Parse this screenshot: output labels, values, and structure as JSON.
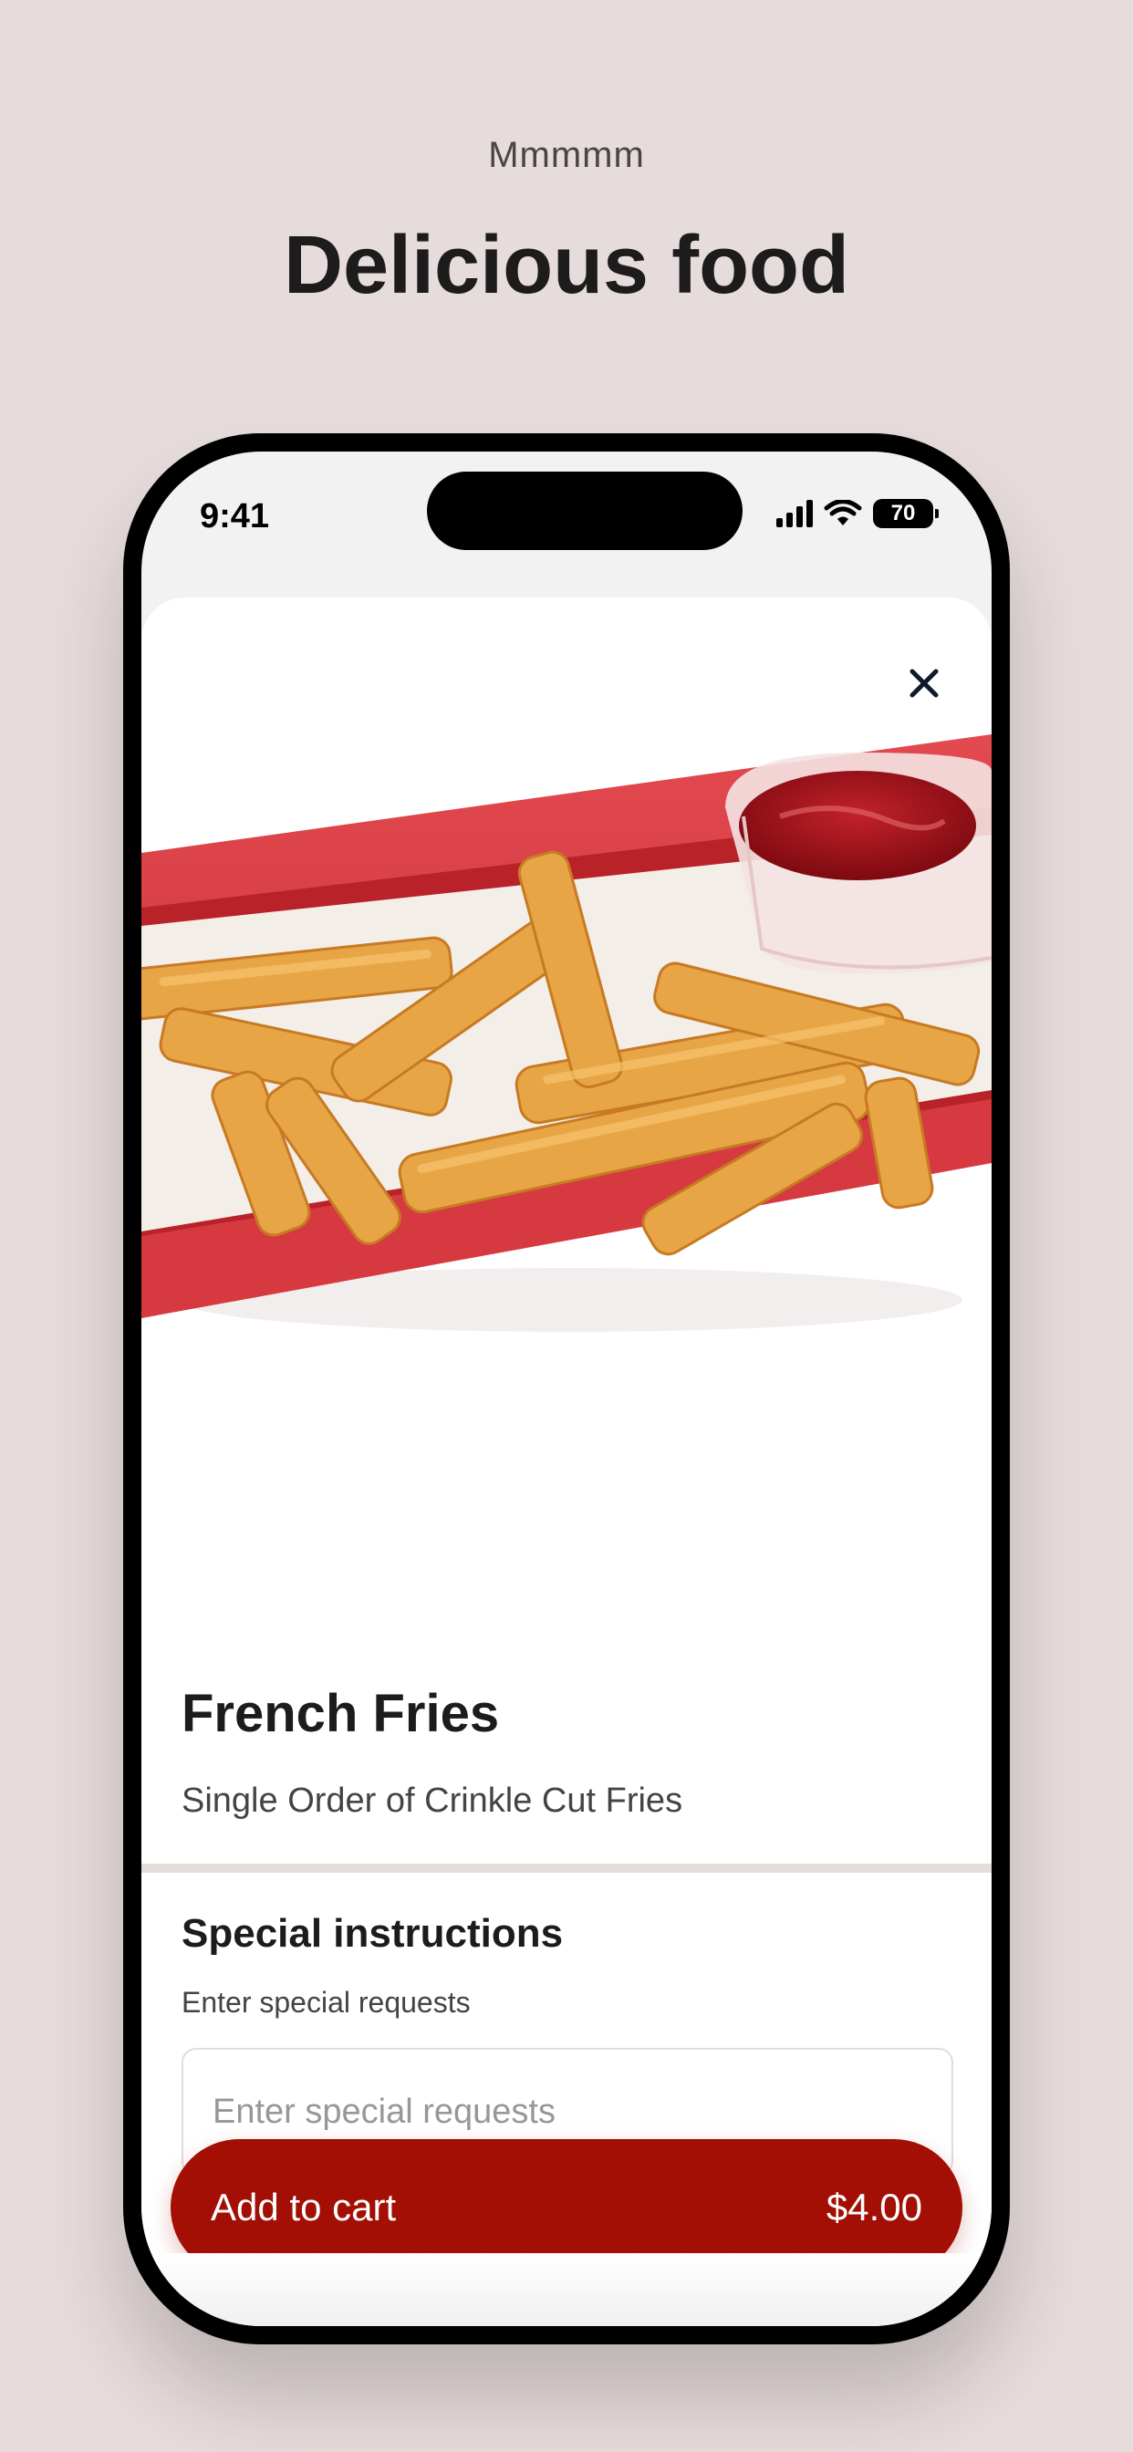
{
  "page": {
    "kicker": "Mmmmm",
    "headline": "Delicious food"
  },
  "status_bar": {
    "time": "9:41",
    "battery": "70",
    "icons": [
      "signal-icon",
      "wifi-icon",
      "battery-icon"
    ]
  },
  "sheet": {
    "close_icon": "close-icon"
  },
  "product": {
    "name": "French Fries",
    "description": "Single Order of Crinkle Cut Fries",
    "image": "french-fries-photo"
  },
  "instructions": {
    "title": "Special instructions",
    "label": "Enter special requests",
    "placeholder": "Enter special requests",
    "value": ""
  },
  "cart_button": {
    "label": "Add to cart",
    "price": "$4.00"
  },
  "colors": {
    "background": "#e6dcdb",
    "accent": "#a30f04",
    "tray": "#d7343b",
    "ketchup": "#a3121a",
    "fries": "#e8a546"
  }
}
